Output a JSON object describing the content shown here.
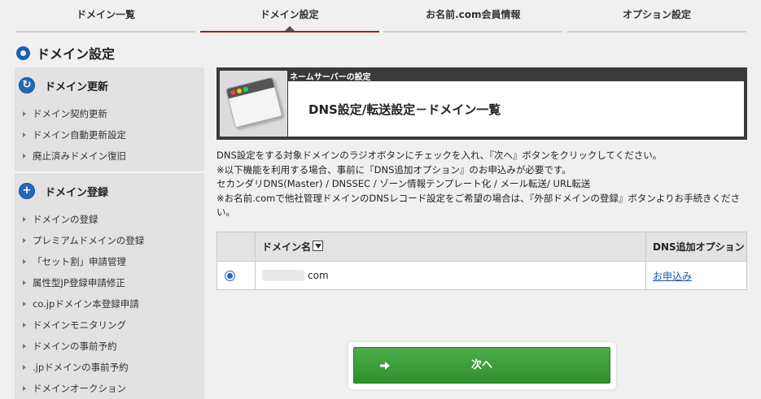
{
  "tabs": [
    {
      "label": "ドメイン一覧",
      "active": false
    },
    {
      "label": "ドメイン設定",
      "active": true
    },
    {
      "label": "お名前.com会員情報",
      "active": false
    },
    {
      "label": "オプション設定",
      "active": false
    }
  ],
  "page_title": "ドメイン設定",
  "sidebar": {
    "sections": [
      {
        "title": "ドメイン更新",
        "icon": "refresh-icon",
        "items": [
          "ドメイン契約更新",
          "ドメイン自動更新設定",
          "廃止済みドメイン復旧"
        ]
      },
      {
        "title": "ドメイン登録",
        "icon": "plus-icon",
        "items": [
          "ドメインの登録",
          "プレミアムドメインの登録",
          "「セット割」申請管理",
          "属性型JP登録申請修正",
          "co.jpドメイン本登録申請",
          "ドメインモニタリング",
          "ドメインの事前予約",
          ".jpドメインの事前予約",
          "ドメインオークション"
        ]
      }
    ]
  },
  "panel": {
    "subtitle": "ネームサーバーの設定",
    "heading": "DNS設定/転送設定－ドメイン一覧"
  },
  "description": [
    "DNS設定をする対象ドメインのラジオボタンにチェックを入れ、『次へ』ボタンをクリックしてください。",
    "※以下機能を利用する場合、事前に『DNS追加オプション』のお申込みが必要です。",
    "セカンダリDNS(Master) / DNSSEC / ゾーン情報テンプレート化 / メール転送/ URL転送",
    "※お名前.comで他社管理ドメインのDNSレコード設定をご希望の場合は、『外部ドメインの登録』ボタンよりお手続きください。"
  ],
  "table": {
    "headers": [
      "",
      "ドメイン名",
      "DNS追加オプション"
    ],
    "rows": [
      {
        "selected": true,
        "domain": "com",
        "option_link": "お申込み"
      }
    ]
  },
  "next_button": "次へ",
  "colors": {
    "accent_red": "#b01818",
    "brand_blue": "#1e5fb0",
    "button_green": "#3a9d37",
    "panel_dark": "#3a3a3a"
  }
}
